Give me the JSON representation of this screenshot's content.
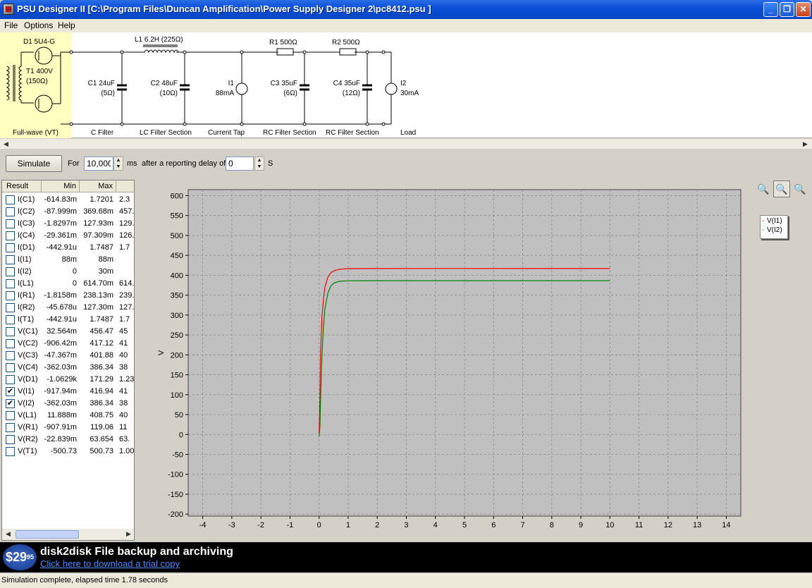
{
  "window": {
    "title": "PSU Designer II  [C:\\Program Files\\Duncan Amplification\\Power Supply Designer 2\\pc8412.psu ]",
    "minimize": "_",
    "restore": "❐",
    "close": "✕"
  },
  "menu": [
    {
      "label": "File"
    },
    {
      "label": "Options"
    },
    {
      "label": "Help"
    }
  ],
  "schematic": {
    "d1": "D1 5U4-G",
    "t1_a": "T1 400V",
    "t1_b": "(150Ω)",
    "l1": "L1 6.2H (225Ω)",
    "c1_a": "C1 24uF",
    "c1_b": "(5Ω)",
    "c2_a": "C2 48uF",
    "c2_b": "(10Ω)",
    "i1_a": "I1",
    "i1_b": "88mA",
    "r1": "R1 500Ω",
    "c3_a": "C3 35uF",
    "c3_b": "(6Ω)",
    "r2": "R2 500Ω",
    "c4_a": "C4 35uF",
    "c4_b": "(12Ω)",
    "i2_a": "I2",
    "i2_b": "30mA",
    "sections": [
      "Full-wave (VT)",
      "C Filter",
      "LC Filter Section",
      "Current Tap",
      "RC Filter Section",
      "RC Filter Section",
      "Load"
    ]
  },
  "simbar": {
    "simulate_label": "Simulate",
    "for_label": "For",
    "duration_value": "10,000",
    "ms_label": "ms",
    "delay_label": "after a reporting delay of",
    "delay_value": "0",
    "s_label": "S"
  },
  "results": {
    "headers": [
      "Result",
      "Min",
      "Max"
    ],
    "rows": [
      {
        "name": "I(C1)",
        "min": "-614.83m",
        "max": "1.7201",
        "extra": "2.3",
        "checked": false
      },
      {
        "name": "I(C2)",
        "min": "-87.999m",
        "max": "369.68m",
        "extra": "457.",
        "checked": false
      },
      {
        "name": "I(C3)",
        "min": "-1.8297m",
        "max": "127.93m",
        "extra": "129.",
        "checked": false
      },
      {
        "name": "I(C4)",
        "min": "-29.361m",
        "max": "97.309m",
        "extra": "126.",
        "checked": false
      },
      {
        "name": "I(D1)",
        "min": "-442.91u",
        "max": "1.7487",
        "extra": "1.7",
        "checked": false
      },
      {
        "name": "I(I1)",
        "min": "88m",
        "max": "88m",
        "extra": "",
        "checked": false
      },
      {
        "name": "I(I2)",
        "min": "0",
        "max": "30m",
        "extra": "",
        "checked": false
      },
      {
        "name": "I(L1)",
        "min": "0",
        "max": "614.70m",
        "extra": "614.",
        "checked": false
      },
      {
        "name": "I(R1)",
        "min": "-1.8158m",
        "max": "238.13m",
        "extra": "239.",
        "checked": false
      },
      {
        "name": "I(R2)",
        "min": "-45.678u",
        "max": "127.30m",
        "extra": "127.",
        "checked": false
      },
      {
        "name": "I(T1)",
        "min": "-442.91u",
        "max": "1.7487",
        "extra": "1.7",
        "checked": false
      },
      {
        "name": "V(C1)",
        "min": "32.564m",
        "max": "456.47",
        "extra": "45",
        "checked": false
      },
      {
        "name": "V(C2)",
        "min": "-906.42m",
        "max": "417.12",
        "extra": "41",
        "checked": false
      },
      {
        "name": "V(C3)",
        "min": "-47.367m",
        "max": "401.88",
        "extra": "40",
        "checked": false
      },
      {
        "name": "V(C4)",
        "min": "-362.03m",
        "max": "386.34",
        "extra": "38",
        "checked": false
      },
      {
        "name": "V(D1)",
        "min": "-1.0629k",
        "max": "171.29",
        "extra": "1.23",
        "checked": false
      },
      {
        "name": "V(I1)",
        "min": "-917.94m",
        "max": "416.94",
        "extra": "41",
        "checked": true
      },
      {
        "name": "V(I2)",
        "min": "-362.03m",
        "max": "386.34",
        "extra": "38",
        "checked": true
      },
      {
        "name": "V(L1)",
        "min": "11.888m",
        "max": "408.75",
        "extra": "40",
        "checked": false
      },
      {
        "name": "V(R1)",
        "min": "-907.91m",
        "max": "119.06",
        "extra": "11",
        "checked": false
      },
      {
        "name": "V(R2)",
        "min": "-22.839m",
        "max": "63.654",
        "extra": "63.",
        "checked": false
      },
      {
        "name": "V(T1)",
        "min": "-500.73",
        "max": "500.73",
        "extra": "1.00",
        "checked": false
      }
    ]
  },
  "chart_data": {
    "type": "line",
    "ylabel": "V",
    "xlim": [
      -4.5,
      14.5
    ],
    "ylim": [
      -205,
      615
    ],
    "xticks": [
      -4,
      -3,
      -2,
      -1,
      0,
      1,
      2,
      3,
      4,
      5,
      6,
      7,
      8,
      9,
      10,
      11,
      12,
      13,
      14
    ],
    "yticks": [
      600,
      550,
      500,
      450,
      400,
      350,
      300,
      250,
      200,
      150,
      100,
      50,
      0,
      -50,
      -100,
      -150,
      -200
    ],
    "grid": true,
    "legend_position": "top-right",
    "series": [
      {
        "name": "V(I1)",
        "color": "#ff0000",
        "x": [
          0,
          0.02,
          0.05,
          0.1,
          0.15,
          0.2,
          0.3,
          0.4,
          0.5,
          0.7,
          1,
          2,
          5,
          10
        ],
        "y": [
          0,
          60,
          200,
          295,
          340,
          370,
          395,
          406,
          411,
          415,
          416.5,
          416.9,
          416.94,
          416.9
        ]
      },
      {
        "name": "V(I2)",
        "color": "#008000",
        "x": [
          0,
          0.03,
          0.05,
          0.1,
          0.15,
          0.2,
          0.3,
          0.4,
          0.5,
          0.7,
          1,
          2,
          5,
          10
        ],
        "y": [
          -5,
          20,
          80,
          200,
          270,
          315,
          355,
          372,
          380,
          385,
          386,
          386.3,
          386.34,
          386.3
        ]
      }
    ]
  },
  "zoom": {
    "zoom_in_icon": "🔍",
    "zoom_box_icon": "🔍",
    "zoom_out_icon": "🔍"
  },
  "ad": {
    "price": "$29",
    "price_cents": "95",
    "title": "disk2disk File backup and archiving",
    "link": "Click here to download a trial copy"
  },
  "status": "Simulation complete, elapsed time 1.78 seconds"
}
